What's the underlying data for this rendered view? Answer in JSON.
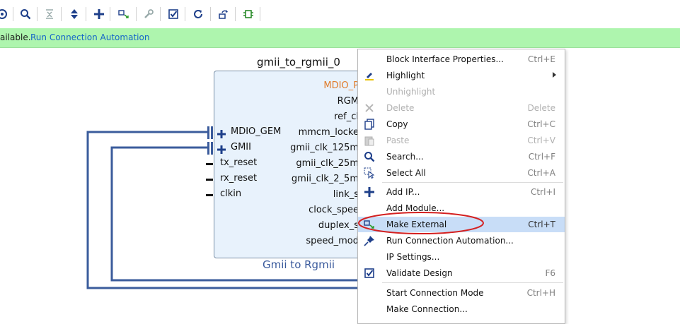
{
  "toolbar": {
    "icons": [
      "origin-icon",
      "zoom-icon",
      "collapse-icon",
      "expand-collapse-icon",
      "add-icon",
      "make-external-icon",
      "wrench-icon",
      "validate-icon",
      "refresh-icon",
      "regenerate-layout-icon",
      "ip-icon"
    ]
  },
  "banner": {
    "message": "ailable.",
    "link": "Run Connection Automation"
  },
  "block": {
    "title": "gmii_to_rgmii_0",
    "subtitle": "Gmii to Rgmii",
    "left_ports": [
      "MDIO_GEM",
      "GMII",
      "tx_reset",
      "rx_reset",
      "clkin"
    ],
    "right_ports": [
      "MDIO_P",
      "RGM",
      "ref_cl",
      "mmcm_locke",
      "gmii_clk_125m",
      "gmii_clk_25m",
      "gmii_clk_2_5m",
      "link_s",
      "clock_spee",
      "duplex_s",
      "speed_mod"
    ]
  },
  "menu": {
    "items": [
      {
        "label": "Block Interface Properties...",
        "shortcut": "Ctrl+E"
      },
      {
        "label": "Highlight",
        "shortcut": ""
      },
      {
        "label": "Unhighlight",
        "shortcut": ""
      },
      {
        "label": "Delete",
        "shortcut": "Delete"
      },
      {
        "label": "Copy",
        "shortcut": "Ctrl+C"
      },
      {
        "label": "Paste",
        "shortcut": "Ctrl+V"
      },
      {
        "label": "Search...",
        "shortcut": "Ctrl+F"
      },
      {
        "label": "Select All",
        "shortcut": "Ctrl+A"
      },
      {
        "label": "Add IP...",
        "shortcut": "Ctrl+I"
      },
      {
        "label": "Add Module...",
        "shortcut": ""
      },
      {
        "label": "Make External",
        "shortcut": "Ctrl+T"
      },
      {
        "label": "Run Connection Automation...",
        "shortcut": ""
      },
      {
        "label": "IP Settings...",
        "shortcut": ""
      },
      {
        "label": "Validate Design",
        "shortcut": "F6"
      },
      {
        "label": "Start Connection Mode",
        "shortcut": "Ctrl+H"
      },
      {
        "label": "Make Connection...",
        "shortcut": ""
      }
    ]
  },
  "colors": {
    "banner_bg": "#aef5ae",
    "link": "#1565c8",
    "wire": "#3b5c9c",
    "block_bg": "#e8f2fc",
    "highlight": "#c8ddf7",
    "annotation": "#d42020",
    "mdio_port": "#e07b2a"
  }
}
